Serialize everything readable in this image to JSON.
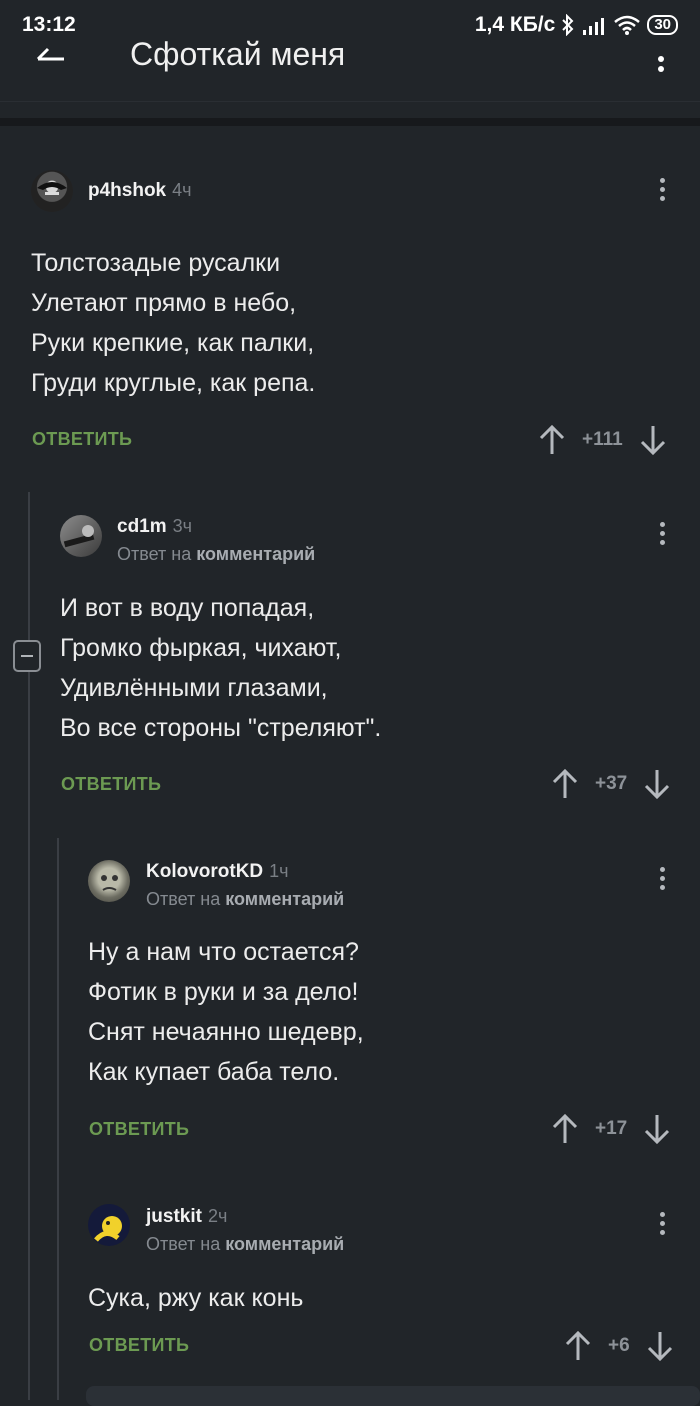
{
  "status_bar": {
    "time": "13:12",
    "network_speed": "1,4 КБ/с",
    "battery": "30"
  },
  "header": {
    "title": "Сфоткай меня"
  },
  "comments": [
    {
      "username": "p4hshok",
      "time": "4ч",
      "reply_to": "",
      "lines": [
        "Толстозадые русалки",
        "Улетают прямо в небо,",
        "Руки крепкие, как палки,",
        "Груди круглые, как репа."
      ],
      "reply_label": "ОТВЕТИТЬ",
      "score": "+111"
    },
    {
      "username": "cd1m",
      "time": "3ч",
      "reply_to_prefix": "Ответ на",
      "reply_to_target": "комментарий",
      "lines": [
        "И вот в воду попадая,",
        "Громко фыркая, чихают,",
        "Удивлёнными глазами,",
        "Во все стороны \"стреляют\"."
      ],
      "reply_label": "ОТВЕТИТЬ",
      "score": "+37"
    },
    {
      "username": "KolovorotKD",
      "time": "1ч",
      "reply_to_prefix": "Ответ на",
      "reply_to_target": "комментарий",
      "lines": [
        "Ну а нам что остается?",
        "Фотик в руки и за дело!",
        "Снят нечаянно шедевр,",
        "Как купает баба тело."
      ],
      "reply_label": "ОТВЕТИТЬ",
      "score": "+17"
    },
    {
      "username": "justkit",
      "time": "2ч",
      "reply_to_prefix": "Ответ на",
      "reply_to_target": "комментарий",
      "lines": [
        "Сука, ржу как конь"
      ],
      "reply_label": "ОТВЕТИТЬ",
      "score": "+6"
    }
  ],
  "colors": {
    "background": "#212529",
    "reply_accent": "#6c9a52"
  }
}
